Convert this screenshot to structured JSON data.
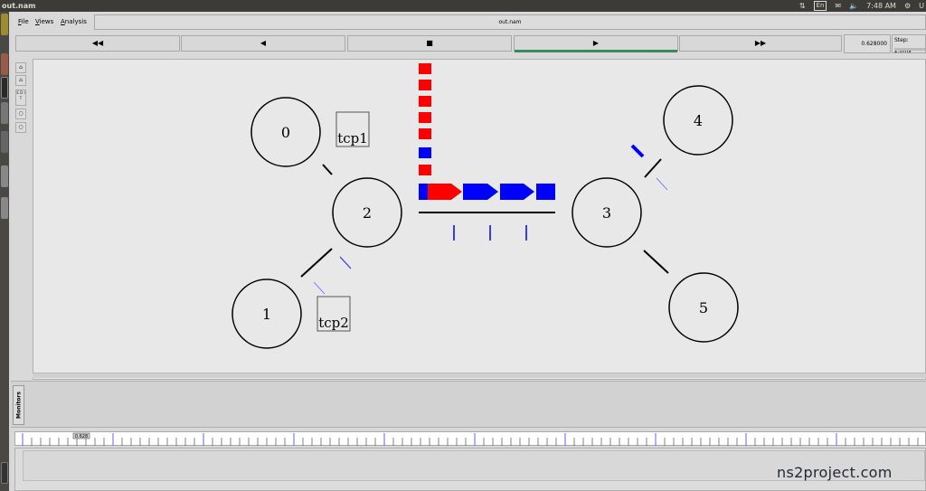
{
  "os": {
    "title": "out.nam",
    "lang": "En",
    "time": "7:48 AM",
    "user": "U",
    "sync_icon": "sync-icon",
    "volume_icon": "volume-icon",
    "gear_icon": "gear-icon"
  },
  "menu": {
    "file": "File",
    "views": "Views",
    "analysis": "Analysis",
    "window_title": "out.nam"
  },
  "controls": {
    "rewind": "◀◀",
    "back": "◀",
    "stop": "■",
    "play": "▶",
    "fast_forward": "▶▶",
    "time": "0.628000",
    "step": "Step: 2.0ms",
    "active_color": "#3a8a5a"
  },
  "tools": {
    "zoom_in": "zoom-in-icon",
    "zoom_out": "zoom-out-icon",
    "edit": "E D I T"
  },
  "topology": {
    "nodes": [
      {
        "id": "0",
        "label": "0"
      },
      {
        "id": "1",
        "label": "1"
      },
      {
        "id": "2",
        "label": "2"
      },
      {
        "id": "3",
        "label": "3"
      },
      {
        "id": "4",
        "label": "4"
      },
      {
        "id": "5",
        "label": "5"
      }
    ],
    "agents": [
      {
        "label": "tcp1"
      },
      {
        "label": "tcp2"
      }
    ],
    "colors": {
      "red": "#ff0000",
      "blue": "#0000ff",
      "link": "#000000"
    }
  },
  "monitors": {
    "label": "Monitors"
  },
  "timeline": {
    "marker": "0.628"
  },
  "watermark": "ns2project.com"
}
